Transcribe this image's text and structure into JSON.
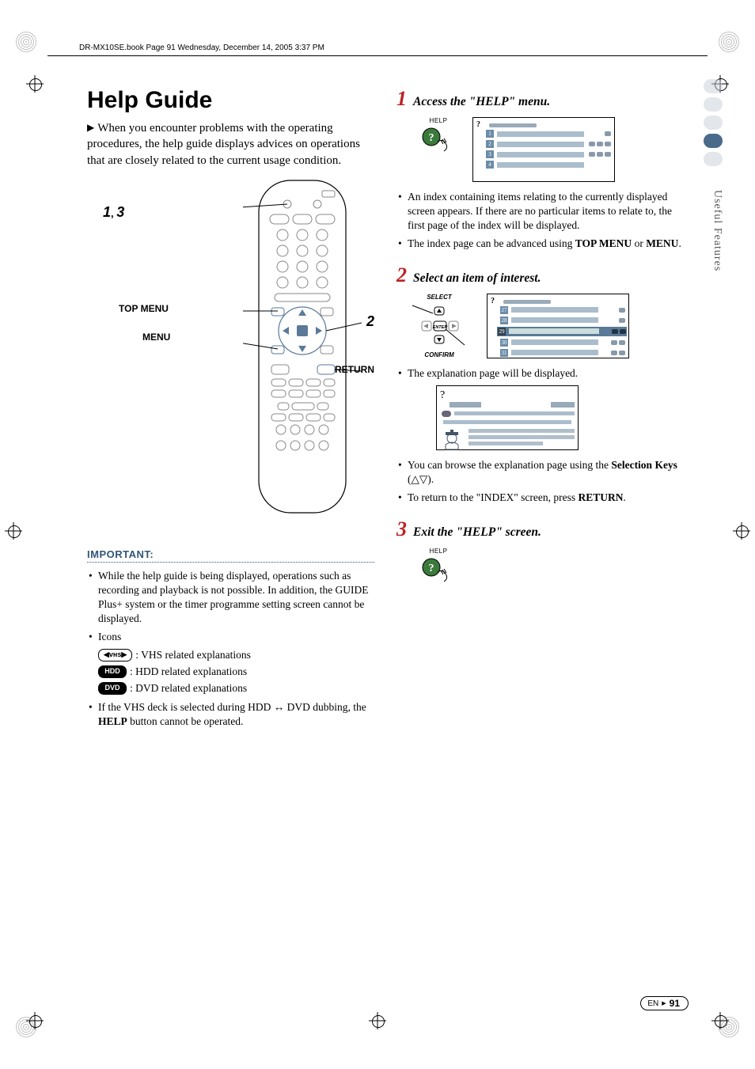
{
  "book_line": "DR-MX10SE.book  Page 91  Wednesday, December 14, 2005  3:37 PM",
  "side_label": "Useful Features",
  "title": "Help Guide",
  "intro": "When you encounter problems with the operating procedures, the help guide displays advices on operations that are closely related to the current usage condition.",
  "remote": {
    "callout_13_a": "1",
    "callout_13_b": "3",
    "callout_13_sep": ", ",
    "topmenu": "TOP MENU",
    "menu": "MENU",
    "callout_2": "2",
    "return": "RETURN"
  },
  "important_heading": "IMPORTANT:",
  "important": {
    "b1": "While the help guide is being displayed, operations such as recording and playback is not possible. In addition, the GUIDE Plus+ system or the timer programme setting screen cannot be displayed.",
    "icons_label": "Icons",
    "icon_vhs": ": VHS related explanations",
    "icon_hdd": ": HDD related explanations",
    "icon_dvd": ": DVD related explanations",
    "b2_pre": "If the VHS deck is selected during HDD ",
    "b2_post": " DVD dubbing, the ",
    "b2_bold": "HELP",
    "b2_end": " button cannot be operated."
  },
  "steps": {
    "s1": {
      "num": "1",
      "title": "Access the \"HELP\" menu.",
      "help_label": "HELP",
      "bullet1": "An index containing items relating to the currently displayed screen appears. If there are no particular items to relate to, the first page of the index will be displayed.",
      "bullet2_pre": "The index page can be advanced using ",
      "bullet2_b1": "TOP MENU",
      "bullet2_mid": " or ",
      "bullet2_b2": "MENU",
      "bullet2_end": "."
    },
    "s2": {
      "num": "2",
      "title": "Select an item of interest.",
      "select_label": "SELECT",
      "confirm_label": "CONFIRM",
      "enter_label": "ENTER",
      "bullet1": "The explanation page will be displayed.",
      "bullet2_pre": "You can browse the explanation page using the ",
      "bullet2_b": "Selection Keys",
      "bullet2_end": " (△▽).",
      "bullet3_pre": "To return to the \"INDEX\" screen, press ",
      "bullet3_b": "RETURN",
      "bullet3_end": "."
    },
    "s3": {
      "num": "3",
      "title": "Exit the \"HELP\" screen.",
      "help_label": "HELP"
    }
  },
  "footer": {
    "lang": "EN",
    "page": "91"
  }
}
